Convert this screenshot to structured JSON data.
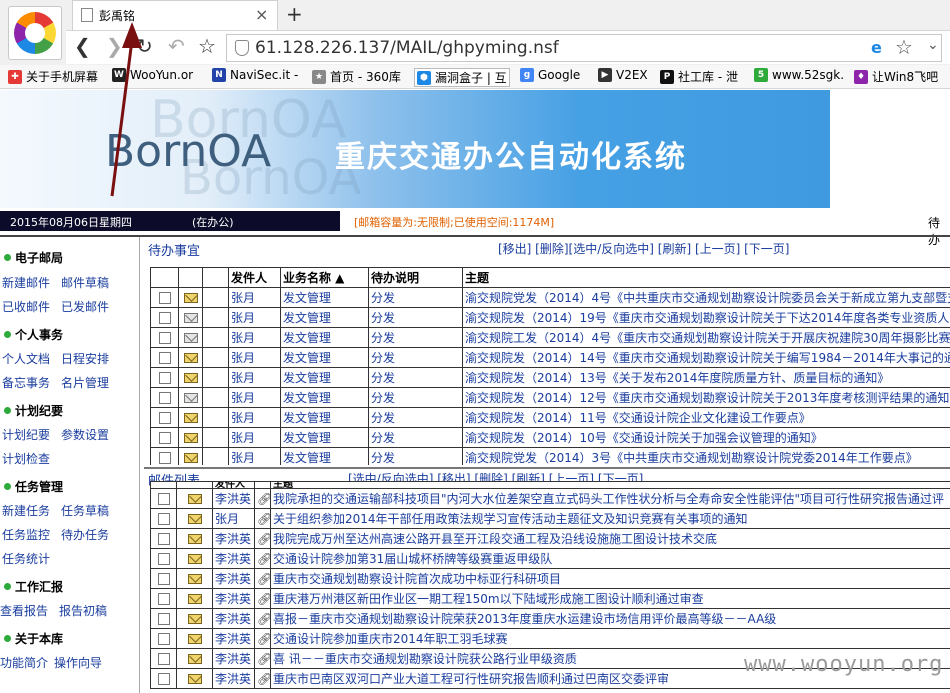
{
  "browser": {
    "tab_title": "彭禹铭",
    "tab_close": "×",
    "new_tab": "+",
    "url": "61.128.226.137/MAIL/ghpyming.nsf",
    "bookmarks": [
      {
        "label": "关于手机屏幕",
        "color": "#e53935"
      },
      {
        "label": "WooYun.or",
        "color": "#222222"
      },
      {
        "label": "NaviSec.it -",
        "color": "#2244aa"
      },
      {
        "label": "首页 - 360库",
        "color": "#888888"
      },
      {
        "label": "漏洞盒子 | 互",
        "color": "#1e88e5"
      },
      {
        "label": "Google",
        "color": "#4285f4"
      },
      {
        "label": "V2EX",
        "color": "#333333"
      },
      {
        "label": "社工库 - 泄",
        "color": "#111111"
      },
      {
        "label": "www.52sgk.",
        "color": "#2eaa3a"
      },
      {
        "label": "让Win8飞吧",
        "color": "#8e24aa"
      }
    ]
  },
  "banner": {
    "logo": "BornOA",
    "title": "重庆交通办公自动化系统"
  },
  "status": {
    "date": "2015年08月06日星期四",
    "online": "(在办公)",
    "quota": "[邮箱容量为:无限制;已使用空间:1174M]",
    "right_label": "待办"
  },
  "menu": [
    {
      "heading": "电子邮局",
      "links": [
        "新建邮件",
        "邮件草稿",
        "已收邮件",
        "已发邮件"
      ]
    },
    {
      "heading": "个人事务",
      "links": [
        "个人文档",
        "日程安排",
        "备忘事务",
        "名片管理"
      ]
    },
    {
      "heading": "计划纪要",
      "links": [
        "计划纪要",
        "参数设置",
        "计划检查"
      ]
    },
    {
      "heading": "任务管理",
      "links": [
        "新建任务",
        "任务草稿",
        "任务监控",
        "待办任务",
        "任务统计"
      ]
    },
    {
      "heading": "工作汇报",
      "links": [
        "查看报告",
        "报告初稿"
      ]
    },
    {
      "heading": "关于本库",
      "links": [
        "功能简介",
        "操作向导"
      ]
    }
  ],
  "pending": {
    "title": "待办事宜",
    "actions": "[移出] [删除][选中/反向选中] [刷新] [上一页] [下一页]",
    "columns": [
      "发件人",
      "业务名称 ▲",
      "待办说明",
      "主题"
    ],
    "rows": [
      {
        "sender": "张月",
        "biz": "发文管理",
        "note": "分发",
        "subject": "渝交规院党发（2014）4号《中共重庆市交通规划勘察设计院委员会关于新成立第九支部暨支",
        "icon": "closed"
      },
      {
        "sender": "张月",
        "biz": "发文管理",
        "note": "分发",
        "subject": "渝交规院发（2014）19号《重庆市交通规划勘察设计院关于下达2014年度各类专业资质人员有",
        "icon": "open"
      },
      {
        "sender": "张月",
        "biz": "发文管理",
        "note": "分发",
        "subject": "渝交规院工发（2014）4号《重庆市交通规划勘察设计院关于开展庆祝建院30周年摄影比赛的",
        "icon": "open"
      },
      {
        "sender": "张月",
        "biz": "发文管理",
        "note": "分发",
        "subject": "渝交规院发（2014）14号《重庆市交通规划勘察设计院关于编写1984－2014年大事记的通知》",
        "icon": "closed"
      },
      {
        "sender": "张月",
        "biz": "发文管理",
        "note": "分发",
        "subject": "渝交规院发（2014）13号《关于发布2014年度院质量方针、质量目标的通知》",
        "icon": "closed"
      },
      {
        "sender": "张月",
        "biz": "发文管理",
        "note": "分发",
        "subject": "渝交规院发（2014）12号《重庆市交通规划勘察设计院关于2013年度考核测评结果的通知》",
        "icon": "open"
      },
      {
        "sender": "张月",
        "biz": "发文管理",
        "note": "分发",
        "subject": "渝交规院发（2014）11号《交通设计院企业文化建设工作要点》",
        "icon": "closed"
      },
      {
        "sender": "张月",
        "biz": "发文管理",
        "note": "分发",
        "subject": "渝交规院发（2014）10号《交通设计院关于加强会议管理的通知》",
        "icon": "closed"
      },
      {
        "sender": "张月",
        "biz": "发文管理",
        "note": "分发",
        "subject": "渝交规院党发（2014）3号《中共重庆市交通规划勘察设计院党委2014年工作要点》",
        "icon": "closed"
      }
    ]
  },
  "mail": {
    "title": "邮件列表",
    "actions": "[选中/反向选中] [移出] [删除] [刷新] [上一页] [下一页]",
    "columns": [
      "发件人",
      "主题"
    ],
    "rows": [
      {
        "sender": "李洪英",
        "subject": "我院承担的交通运输部科技项目\"内河大水位差架空直立式码头工作性状分析与全寿命安全性能评估\"项目可行性研究报告通过评"
      },
      {
        "sender": "张月",
        "subject": "关于组织参加2014年干部任用政策法规学习宣传活动主题征文及知识竞赛有关事项的通知"
      },
      {
        "sender": "李洪英",
        "subject": "我院完成万州至达州高速公路开县至开江段交通工程及沿线设施施工图设计技术交底"
      },
      {
        "sender": "李洪英",
        "subject": "交通设计院参加第31届山城杯桥牌等级赛重返甲级队"
      },
      {
        "sender": "李洪英",
        "subject": "重庆市交通规划勘察设计院首次成功中标亚行科研项目"
      },
      {
        "sender": "李洪英",
        "subject": "重庆港万州港区新田作业区一期工程150m以下陆域形成施工图设计顺利通过审查"
      },
      {
        "sender": "李洪英",
        "subject": "喜报－重庆市交通规划勘察设计院荣获2013年度重庆水运建设市场信用评价最高等级－－AA级"
      },
      {
        "sender": "李洪英",
        "subject": "交通设计院参加重庆市2014年职工羽毛球赛"
      },
      {
        "sender": "李洪英",
        "subject": "喜 讯－－重庆市交通规划勘察设计院获公路行业甲级资质"
      },
      {
        "sender": "李洪英",
        "subject": "重庆市巴南区双河口产业大道工程可行性研究报告顺利通过巴南区交委评审"
      }
    ]
  },
  "watermark": "www.wooyun.org"
}
